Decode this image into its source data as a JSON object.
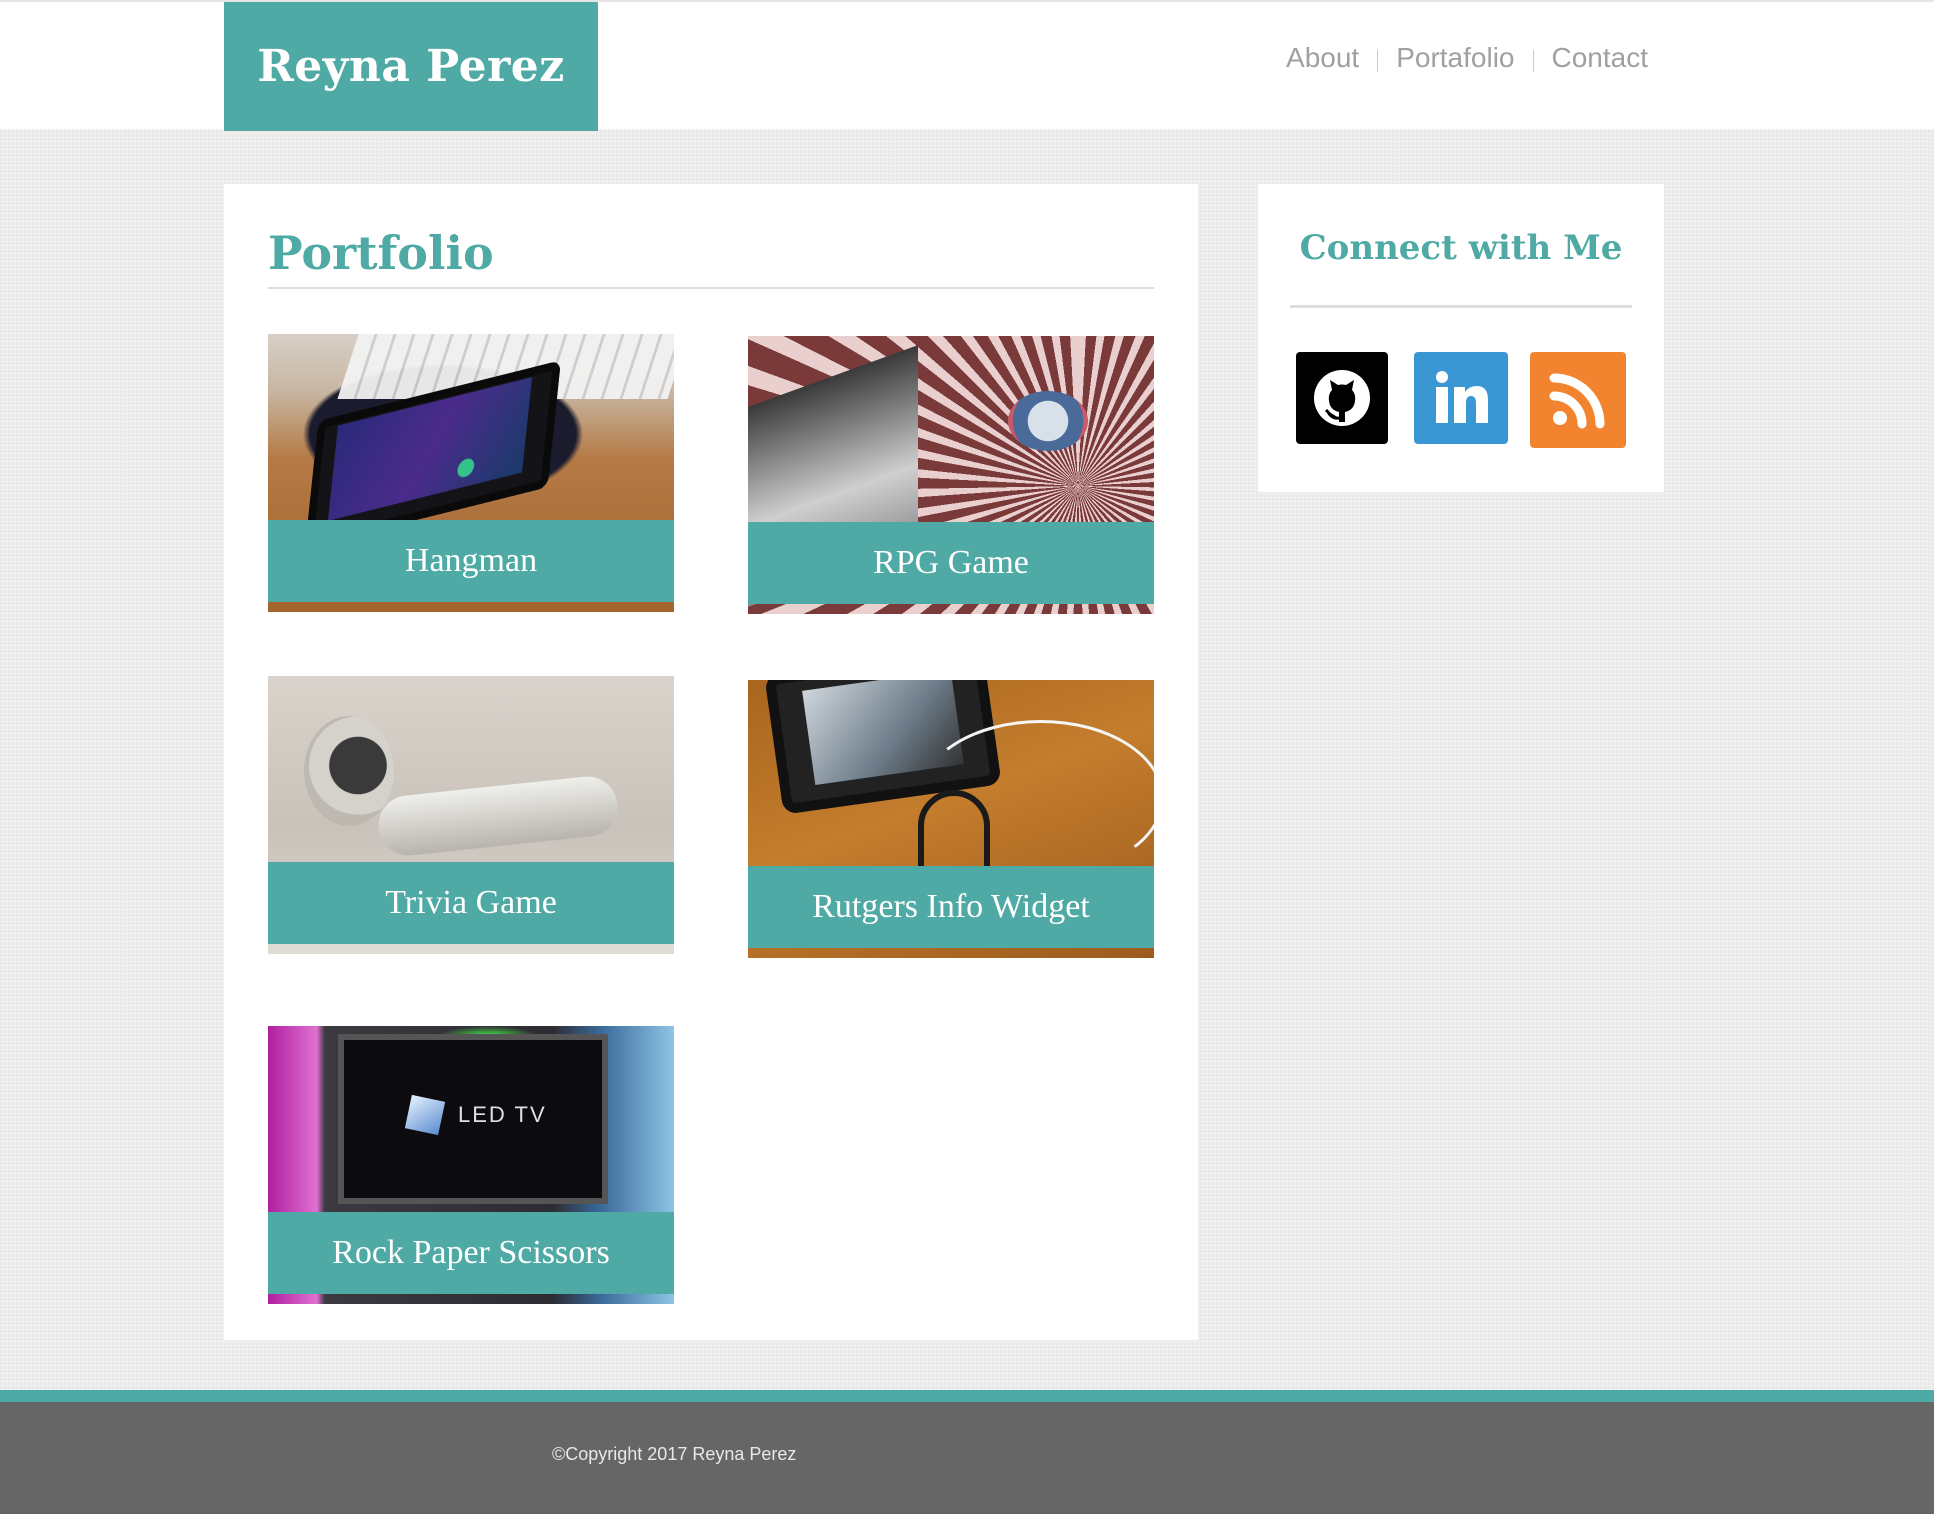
{
  "header": {
    "brand": "Reyna Perez",
    "nav": [
      {
        "label": "About"
      },
      {
        "label": "Portafolio"
      },
      {
        "label": "Contact"
      }
    ]
  },
  "main": {
    "title": "Portfolio",
    "projects": [
      {
        "title": "Hangman"
      },
      {
        "title": "RPG Game"
      },
      {
        "title": "Trivia Game"
      },
      {
        "title": "Rutgers Info Widget"
      },
      {
        "title": "Rock Paper Scissors",
        "photo_text": "LED TV"
      }
    ]
  },
  "sidebar": {
    "title": "Connect with Me",
    "social": [
      {
        "icon": "github-icon",
        "color": "#000000"
      },
      {
        "icon": "linkedin-icon",
        "color": "#3b97d3"
      },
      {
        "icon": "rss-icon",
        "color": "#f3842f"
      }
    ]
  },
  "footer": {
    "copyright": "©Copyright 2017 Reyna Perez"
  },
  "colors": {
    "accent": "#4fa9a4",
    "footer": "#666666",
    "nav_text": "#a0a0a0"
  }
}
